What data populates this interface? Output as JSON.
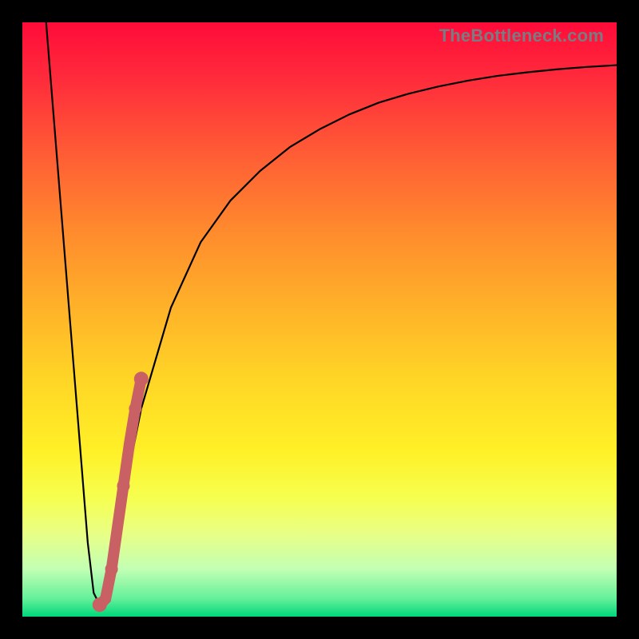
{
  "watermark": "TheBottleneck.com",
  "colors": {
    "frame": "#000000",
    "curve": "#000000",
    "highlight": "#c86064"
  },
  "chart_data": {
    "type": "line",
    "title": "",
    "xlabel": "",
    "ylabel": "",
    "xlim": [
      0,
      100
    ],
    "ylim": [
      0,
      100
    ],
    "grid": false,
    "series": [
      {
        "name": "bottleneck-curve",
        "x": [
          4,
          6,
          8,
          10,
          11,
          12,
          13,
          14,
          15,
          17,
          20,
          25,
          30,
          35,
          40,
          45,
          50,
          55,
          60,
          65,
          70,
          75,
          80,
          85,
          90,
          95,
          100
        ],
        "values": [
          100,
          75,
          50,
          25,
          12,
          4,
          2,
          3,
          7,
          20,
          35,
          52,
          63,
          70,
          75,
          79,
          82,
          84.5,
          86.5,
          88,
          89.2,
          90.2,
          91,
          91.6,
          92.1,
          92.5,
          92.8
        ]
      }
    ],
    "highlight": {
      "name": "highlighted-range",
      "x": [
        13,
        14,
        15,
        16,
        17,
        18,
        19,
        20
      ],
      "values": [
        2,
        3,
        8,
        15,
        22,
        29,
        35,
        40
      ]
    },
    "background_gradient": {
      "top": "#ff0b3a",
      "bottom": "#00d67a",
      "note": "red-to-green vertical gradient"
    }
  }
}
